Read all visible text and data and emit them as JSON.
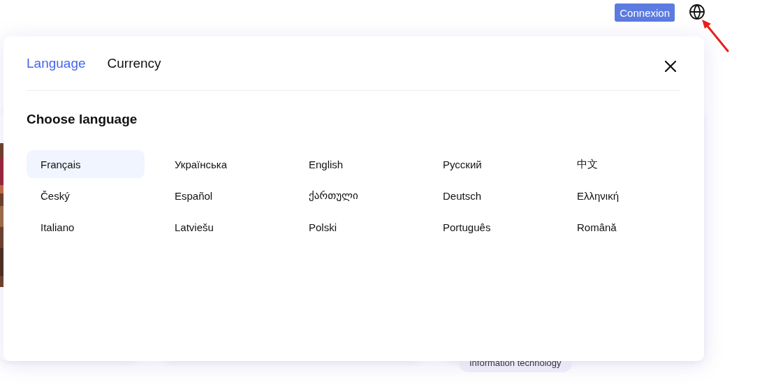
{
  "header": {
    "login_button": "Connexion"
  },
  "background": {
    "tag": "Information technology"
  },
  "dialog": {
    "tabs": [
      {
        "label": "Language",
        "selected": true
      },
      {
        "label": "Currency",
        "selected": false
      }
    ],
    "heading": "Choose language",
    "languages": [
      {
        "label": "Français",
        "selected": true
      },
      {
        "label": "Українська",
        "selected": false
      },
      {
        "label": "English",
        "selected": false
      },
      {
        "label": "Русский",
        "selected": false
      },
      {
        "label": "中文",
        "selected": false
      },
      {
        "label": "Český",
        "selected": false
      },
      {
        "label": "Español",
        "selected": false
      },
      {
        "label": "ქართული",
        "selected": false
      },
      {
        "label": "Deutsch",
        "selected": false
      },
      {
        "label": "Ελληνική",
        "selected": false
      },
      {
        "label": "Italiano",
        "selected": false
      },
      {
        "label": "Latviešu",
        "selected": false
      },
      {
        "label": "Polski",
        "selected": false
      },
      {
        "label": "Português",
        "selected": false
      },
      {
        "label": "Română",
        "selected": false
      }
    ]
  }
}
